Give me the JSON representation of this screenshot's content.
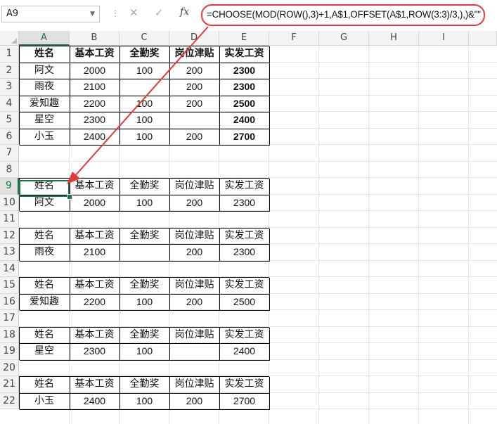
{
  "name_box": "A9",
  "formula": "=CHOOSE(MOD(ROW(),3)+1,A$1,OFFSET(A$1,ROW(3:3)/3,),)&\"\"",
  "columns": [
    "A",
    "B",
    "C",
    "D",
    "E",
    "F",
    "G",
    "H",
    "I"
  ],
  "selected_column": "A",
  "selected_row": "9",
  "rows": [
    "1",
    "2",
    "3",
    "4",
    "5",
    "6",
    "7",
    "8",
    "9",
    "10",
    "11",
    "12",
    "13",
    "14",
    "15",
    "16",
    "17",
    "18",
    "19",
    "20",
    "21",
    "22"
  ],
  "headers": [
    "姓名",
    "基本工资",
    "全勤奖",
    "岗位津贴",
    "实发工资"
  ],
  "source_table": [
    [
      "阿文",
      "2000",
      "100",
      "200",
      "2300"
    ],
    [
      "雨夜",
      "2100",
      "",
      "200",
      "2300"
    ],
    [
      "爱知趣",
      "2200",
      "100",
      "200",
      "2500"
    ],
    [
      "星空",
      "2300",
      "100",
      "",
      "2400"
    ],
    [
      "小玉",
      "2400",
      "100",
      "200",
      "2700"
    ]
  ],
  "slips": [
    [
      "阿文",
      "2000",
      "100",
      "200",
      "2300"
    ],
    [
      "雨夜",
      "2100",
      "",
      "200",
      "2300"
    ],
    [
      "爱知趣",
      "2200",
      "100",
      "200",
      "2500"
    ],
    [
      "星空",
      "2300",
      "100",
      "",
      "2400"
    ],
    [
      "小玉",
      "2400",
      "100",
      "200",
      "2700"
    ]
  ],
  "colors": {
    "highlight": "#e03a3a",
    "excel_green": "#217346"
  }
}
